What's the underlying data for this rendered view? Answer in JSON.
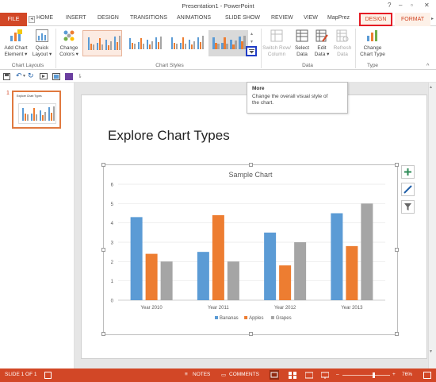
{
  "window": {
    "title": "Presentation1 - PowerPoint",
    "help": "?",
    "minimize": "–",
    "restore": "▫",
    "close": "✕"
  },
  "tabs": {
    "file": "FILE",
    "items": [
      "HOME",
      "INSERT",
      "DESIGN",
      "TRANSITIONS",
      "ANIMATIONS",
      "SLIDE SHOW",
      "REVIEW",
      "VIEW",
      "MapPrez"
    ],
    "design_ctx": "DESIGN",
    "format": "FORMAT"
  },
  "ribbon": {
    "add_chart_element": [
      "Add Chart",
      "Element ▾"
    ],
    "quick_layout": [
      "Quick",
      "Layout ▾"
    ],
    "group_chart_layouts": "Chart Layouts",
    "change_colors": [
      "Change",
      "Colors ▾"
    ],
    "group_chart_styles": "Chart Styles",
    "switch_row_col": [
      "Switch Row/",
      "Column"
    ],
    "select_data": [
      "Select",
      "Data"
    ],
    "edit_data": [
      "Edit",
      "Data ▾"
    ],
    "refresh_data": [
      "Refresh",
      "Data"
    ],
    "group_data": "Data",
    "change_chart_type": [
      "Change",
      "Chart Type"
    ],
    "group_type": "Type"
  },
  "tooltip": {
    "title": "More",
    "desc1": "Change the overall visual style of",
    "desc2": "the chart."
  },
  "thumbnail": {
    "number": "1",
    "title": "Explore Chart Types"
  },
  "slide": {
    "title": "Explore Chart Types"
  },
  "chart_data": {
    "type": "bar",
    "title": "Sample Chart",
    "categories": [
      "Year 2010",
      "Year 2011",
      "Year 2012",
      "Year 2013"
    ],
    "series": [
      {
        "name": "Bananas",
        "color": "#5b9bd5",
        "values": [
          4.3,
          2.5,
          3.5,
          4.5
        ]
      },
      {
        "name": "Apples",
        "color": "#ed7d31",
        "values": [
          2.4,
          4.4,
          1.8,
          2.8
        ]
      },
      {
        "name": "Grapes",
        "color": "#a5a5a5",
        "values": [
          2.0,
          2.0,
          3.0,
          5.0
        ]
      }
    ],
    "ylim": [
      0,
      6
    ],
    "yticks": [
      "0",
      "1",
      "2",
      "3",
      "4",
      "5",
      "6"
    ],
    "grid": true,
    "legend": "bottom"
  },
  "statusbar": {
    "slide": "SLIDE 1 OF 1",
    "notes": "NOTES",
    "comments": "COMMENTS",
    "zoom": "76%"
  },
  "colors": {
    "accent": "#d24726",
    "highlight": "#e51b24",
    "more_box": "#1f3cc7"
  }
}
